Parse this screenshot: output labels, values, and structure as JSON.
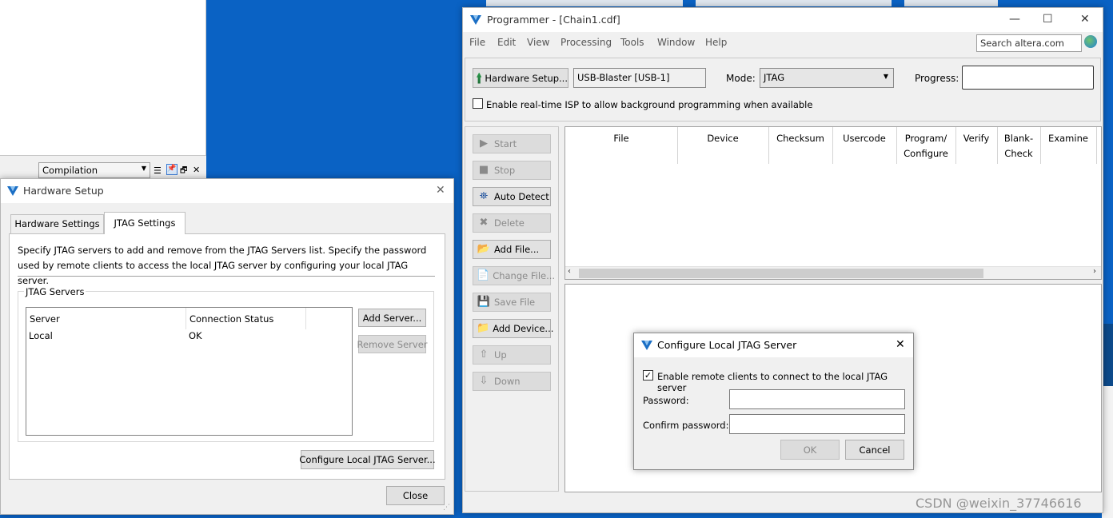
{
  "background_window": {
    "combo_value": "Compilation"
  },
  "hardware_setup": {
    "title": "Hardware Setup",
    "tabs": [
      {
        "label": "Hardware Settings"
      },
      {
        "label": "JTAG Settings"
      }
    ],
    "description": "Specify JTAG servers to add and remove from the JTAG Servers list. Specify the password used by remote clients to access the local JTAG server by configuring your local JTAG server.",
    "group_label": "JTAG Servers",
    "columns": [
      "Server",
      "Connection Status"
    ],
    "rows": [
      {
        "server": "Local",
        "status": "OK"
      }
    ],
    "add_server_label": "Add Server...",
    "remove_server_label": "Remove Server",
    "configure_label": "Configure Local JTAG Server...",
    "close_label": "Close"
  },
  "programmer": {
    "title": "Programmer - [Chain1.cdf]",
    "menu": [
      "File",
      "Edit",
      "View",
      "Processing",
      "Tools",
      "Window",
      "Help"
    ],
    "search_placeholder": "Search altera.com",
    "hardware_setup_label": "Hardware Setup...",
    "hardware_value": "USB-Blaster [USB-1]",
    "mode_label": "Mode:",
    "mode_value": "JTAG",
    "progress_label": "Progress:",
    "isp_label": "Enable real-time ISP to allow background programming when available",
    "side_buttons": [
      {
        "label": "Start",
        "icon": "start-icon"
      },
      {
        "label": "Stop",
        "icon": "stop-icon"
      },
      {
        "label": "Auto Detect",
        "icon": "binoculars-icon"
      },
      {
        "label": "Delete",
        "icon": "delete-icon"
      },
      {
        "label": "Add File...",
        "icon": "add-file-icon"
      },
      {
        "label": "Change File...",
        "icon": "change-file-icon"
      },
      {
        "label": "Save File",
        "icon": "save-icon"
      },
      {
        "label": "Add Device...",
        "icon": "add-device-icon"
      },
      {
        "label": "Up",
        "icon": "up-icon"
      },
      {
        "label": "Down",
        "icon": "down-icon"
      }
    ],
    "columns": {
      "file": "File",
      "device": "Device",
      "checksum": "Checksum",
      "usercode": "Usercode",
      "program_1": "Program/",
      "program_2": "Configure",
      "verify": "Verify",
      "blank_1": "Blank-",
      "blank_2": "Check",
      "examine": "Examine"
    }
  },
  "jtag_dialog": {
    "title": "Configure Local JTAG Server",
    "enable_label": "Enable remote clients to connect to the local JTAG server",
    "password_label": "Password:",
    "confirm_label": "Confirm password:",
    "ok_label": "OK",
    "cancel_label": "Cancel"
  },
  "watermark": "CSDN @weixin_37746616"
}
